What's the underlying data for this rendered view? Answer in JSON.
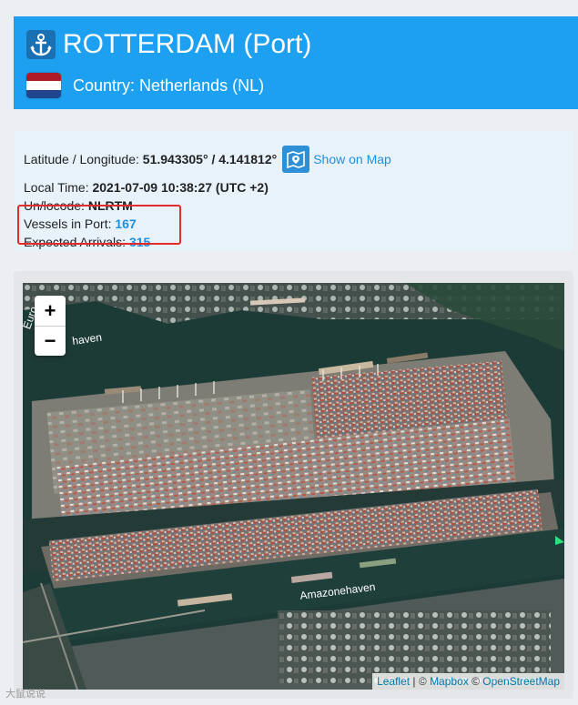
{
  "header": {
    "title": "ROTTERDAM (Port)",
    "country": "Country: Netherlands (NL)",
    "flag_colors": [
      "#ae1c28",
      "#ffffff",
      "#21468b"
    ],
    "brand_color": "#1ea0f0"
  },
  "info": {
    "latlon_label": "Latitude / Longitude:",
    "latlon_value": "51.943305° / 4.141812°",
    "show_on_map": "Show on Map",
    "local_time_label": "Local Time:",
    "local_time_value": "2021-07-09 10:38:27 (UTC +2)",
    "unlocode_label": "Un/locode:",
    "unlocode_value": "NLRTM",
    "vessels_label": "Vessels in Port:",
    "vessels_value": "167",
    "arrivals_label": "Expected Arrivals:",
    "arrivals_value": "315"
  },
  "map": {
    "zoom_in": "+",
    "zoom_out": "−",
    "label_harbor": "Amazonehaven",
    "label_harbor_partial": "Euro",
    "label_haven_partial": "haven",
    "attribution": {
      "leaflet": "Leaflet",
      "sep1": " | © ",
      "mapbox": "Mapbox",
      "sep2": " © ",
      "osm": "OpenStreetMap"
    }
  },
  "watermark": "大鼠说说"
}
